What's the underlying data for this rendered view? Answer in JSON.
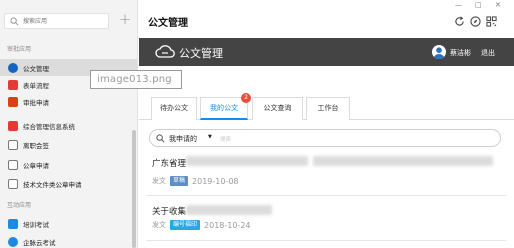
{
  "sidebar": {
    "search_placeholder": "搜索应用",
    "add_label": "+",
    "groups": [
      {
        "title": "审批应用"
      },
      {
        "title": "互动应用"
      }
    ],
    "items": [
      {
        "label": "公文管理",
        "icon": "official-document-icon",
        "color": "#1565c0"
      },
      {
        "label": "表单流程",
        "icon": "form-process-icon",
        "color": "#e53935"
      },
      {
        "label": "审批申请",
        "icon": "approval-request-icon",
        "color": "#d84315"
      },
      {
        "label": "综合管理信息系统",
        "icon": "management-system-icon",
        "color": "#e53935"
      },
      {
        "label": "离职会签",
        "icon": "resignation-signoff-icon",
        "color": "#777777"
      },
      {
        "label": "公章申请",
        "icon": "seal-request-icon",
        "color": "#777777"
      },
      {
        "label": "技术文件类公章申请",
        "icon": "tech-seal-request-icon",
        "color": "#777777"
      },
      {
        "label": "培训考试",
        "icon": "training-exam-icon",
        "color": "#1e88e5"
      },
      {
        "label": "企脉云考试",
        "icon": "cloud-exam-icon",
        "color": "#1e88e5"
      }
    ]
  },
  "image_label": "image013.png",
  "window": {
    "title": "公文管理",
    "minimize": "—",
    "maximize": "□",
    "close": "✕"
  },
  "header": {
    "title": "公文管理",
    "user_name": "蔡洁彬",
    "logout": "退出"
  },
  "tabs": [
    {
      "label": "待办公文",
      "active": false
    },
    {
      "label": "我的公文",
      "active": true,
      "badge": "2"
    },
    {
      "label": "公文查询",
      "active": false
    },
    {
      "label": "工作台",
      "active": false
    }
  ],
  "filter": {
    "selected": "我申请的",
    "placeholder": "搜索"
  },
  "documents": [
    {
      "title": "广东省理",
      "type": "发文",
      "tag": "草稿",
      "tag_color": "#5a8fc7",
      "date": "2019-10-08"
    },
    {
      "title": "关于收集",
      "type": "发文",
      "tag": "编号福印",
      "tag_color": "#26a9e0",
      "date": "2018-10-24"
    }
  ],
  "colors": {
    "header_bg": "#444444",
    "accent": "#1e88e5",
    "badge": "#e74c3c"
  }
}
